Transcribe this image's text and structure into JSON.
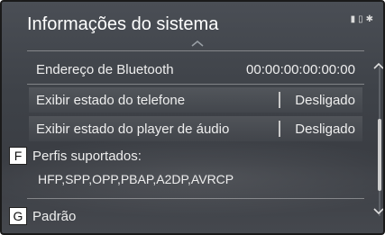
{
  "title": "Informações do sistema",
  "rows": [
    {
      "label": "Endereço de Bluetooth",
      "value": "00:00:00:00:00:00"
    },
    {
      "label": "Exibir estado do telefone",
      "value": "Desligado"
    },
    {
      "label": "Exibir estado do player de áudio",
      "value": "Desligado"
    }
  ],
  "supported": {
    "marker": "F",
    "label": "Perfis suportados:",
    "value": "HFP,SPP,OPP,PBAP,A2DP,AVRCP"
  },
  "default_item": {
    "marker": "G",
    "label": "Padrão"
  },
  "icons": {
    "status": [
      "signal-icon",
      "battery-icon",
      "bluetooth-icon"
    ],
    "scroll_up": "chevron-up-icon",
    "scroll_down": "chevron-down-icon"
  }
}
